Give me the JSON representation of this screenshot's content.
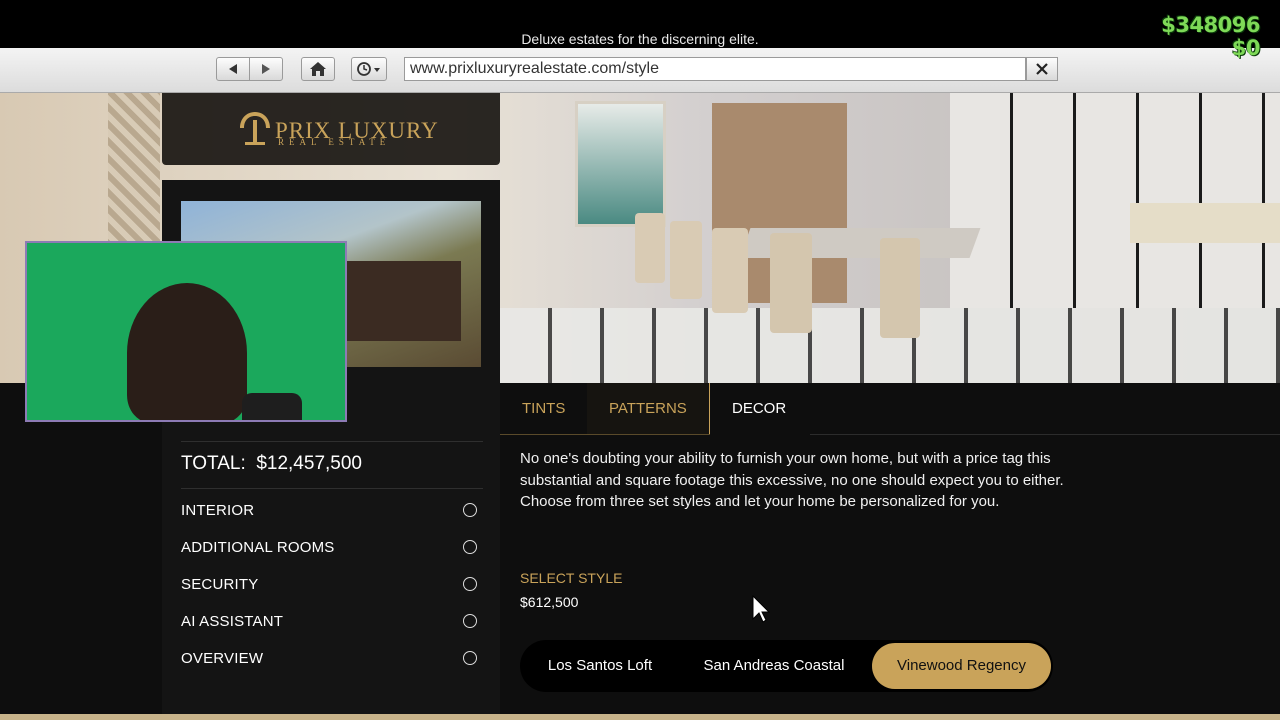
{
  "hud": {
    "cash": "$348096",
    "change": "$0"
  },
  "header": {
    "tagline": "Deluxe estates for the discerning elite."
  },
  "browser": {
    "url": "www.prixluxuryrealestate.com/style"
  },
  "brand": {
    "name": "PRIX LUXURY",
    "subtitle": "REAL ESTATE",
    "color": "#c9a35a"
  },
  "summary": {
    "total_label": "TOTAL:",
    "total_value": "$12,457,500",
    "items": [
      {
        "label": "INTERIOR"
      },
      {
        "label": "ADDITIONAL ROOMS"
      },
      {
        "label": "SECURITY"
      },
      {
        "label": "AI ASSISTANT"
      },
      {
        "label": "OVERVIEW"
      }
    ]
  },
  "tabs": [
    {
      "label": "TINTS",
      "active": false
    },
    {
      "label": "PATTERNS",
      "active": false
    },
    {
      "label": "DECOR",
      "active": true
    }
  ],
  "content": {
    "description": "No one's doubting your ability to furnish your own home, but with a price tag this substantial and square footage this excessive, no one should expect you to either. Choose from three set styles and let your home be personalized for you.",
    "select_label": "SELECT STYLE",
    "price": "$612,500",
    "styles": [
      "Los Santos Loft",
      "San Andreas Coastal",
      "Vinewood Regency"
    ],
    "selected_style": "Vinewood Regency"
  },
  "colors": {
    "accent": "#c9a35a",
    "hud_money": "#7ed957",
    "panel": "#0e0e0e"
  },
  "icons": [
    "back-arrow-icon",
    "forward-arrow-icon",
    "home-icon",
    "history-icon",
    "close-icon",
    "mouse-cursor-icon"
  ]
}
